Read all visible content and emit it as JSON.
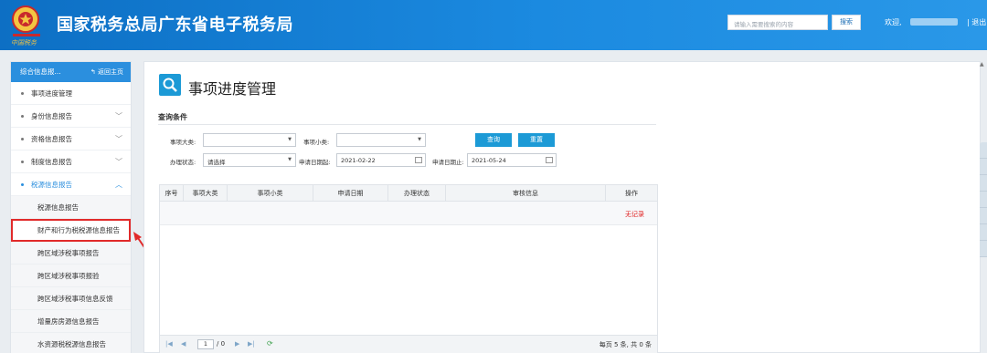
{
  "header": {
    "title": "国家税务总局广东省电子税务局",
    "search_placeholder": "请输入需要搜索的内容",
    "search_button": "搜索",
    "welcome": "欢迎,",
    "logout": "| 退出"
  },
  "sidebar": {
    "title": "综合信息报...",
    "back": "返回主页",
    "items": [
      {
        "label": "事项进度管理"
      },
      {
        "label": "身份信息报告"
      },
      {
        "label": "资格信息报告"
      },
      {
        "label": "制度信息报告"
      },
      {
        "label": "税源信息报告"
      }
    ],
    "subitems": [
      {
        "label": "税源信息报告"
      },
      {
        "label": "财产和行为税税源信息报告"
      },
      {
        "label": "跨区域涉税事项报告"
      },
      {
        "label": "跨区域涉税事项报验"
      },
      {
        "label": "跨区域涉税事项信息反馈"
      },
      {
        "label": "增量房房源信息报告"
      },
      {
        "label": "水资源税税源信息报告"
      }
    ]
  },
  "main": {
    "title": "事项进度管理",
    "query_title": "查询条件",
    "filters": {
      "category_label": "事项大类:",
      "subcategory_label": "事项小类:",
      "status_label": "办理状态:",
      "status_value": "请选择",
      "start_label": "申请日期起:",
      "start_value": "2021-02-22",
      "end_label": "申请日期止:",
      "end_value": "2021-05-24",
      "query_button": "查询",
      "reset_button": "重置"
    },
    "table": {
      "columns": [
        "序号",
        "事项大类",
        "事项小类",
        "申请日期",
        "办理状态",
        "审核信息",
        "操作"
      ],
      "empty_text": "无记录"
    },
    "pager": {
      "page": "1",
      "total_pages": "/ 0",
      "summary": "每页 5 条, 共 0 条"
    }
  },
  "colors": {
    "header": "#1b8ae0",
    "accent": "#1c9ad6",
    "highlight": "#e12a2a"
  }
}
